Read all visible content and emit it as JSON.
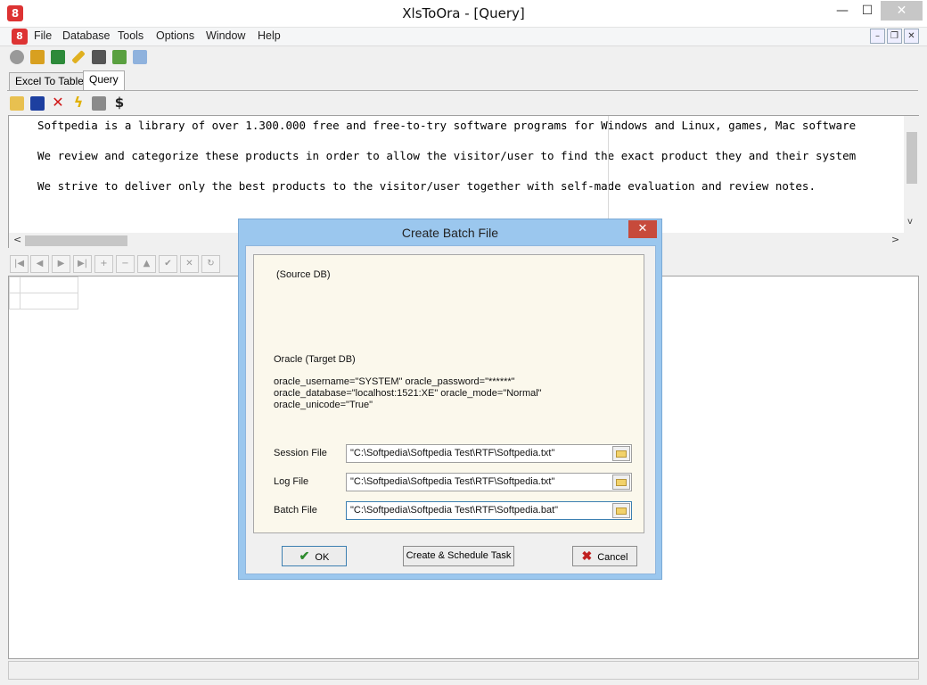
{
  "window": {
    "title": "XlsToOra - [Query]",
    "app_icon_glyph": "8",
    "controls": {
      "minimize": "—",
      "maximize": "☐",
      "close": "✕"
    }
  },
  "menu": {
    "items": [
      "File",
      "Database",
      "Tools",
      "Options",
      "Window",
      "Help"
    ],
    "mdi_controls": {
      "minimize": "–",
      "restore": "❐",
      "close": "✕"
    }
  },
  "tabs": [
    {
      "label": "Excel To Table",
      "active": false
    },
    {
      "label": "Query",
      "active": true
    }
  ],
  "editor": {
    "lines": [
      "Softpedia is a library of over 1.300.000 free and free-to-try software programs for Windows and Linux, games, Mac software",
      "We review and categorize these products in order to allow the visitor/user to find the exact product they and their system",
      "We strive to deliver only the best products to the visitor/user together with self-made evaluation and review notes."
    ],
    "scroll_left": "<",
    "scroll_right": ">",
    "scroll_down": "v"
  },
  "nav_buttons": [
    "|◀",
    "◀",
    "▶",
    "▶|",
    "+",
    "−",
    "▲",
    "✔",
    "✕",
    "↻"
  ],
  "dialog": {
    "title": "Create Batch File",
    "close": "✕",
    "source_label": "(Source DB)",
    "target_label": "Oracle (Target DB)",
    "params": [
      " oracle_username=\"SYSTEM\" oracle_password=\"******\"",
      "oracle_database=\"localhost:1521:XE\" oracle_mode=\"Normal\"",
      "oracle_unicode=\"True\""
    ],
    "fields": [
      {
        "label": "Session File",
        "value": "\"C:\\Softpedia\\Softpedia Test\\RTF\\Softpedia.txt\""
      },
      {
        "label": "Log File",
        "value": "\"C:\\Softpedia\\Softpedia Test\\RTF\\Softpedia.txt\""
      },
      {
        "label": "Batch File",
        "value": "\"C:\\Softpedia\\Softpedia Test\\RTF\\Softpedia.bat\""
      }
    ],
    "ok_label": "OK",
    "schedule_label": "Create & Schedule Task",
    "cancel_label": "Cancel"
  },
  "colors": {
    "dialog_frame": "#9bc7ee",
    "panel_bg": "#fbf8ec",
    "close_red": "#c74a3b"
  }
}
